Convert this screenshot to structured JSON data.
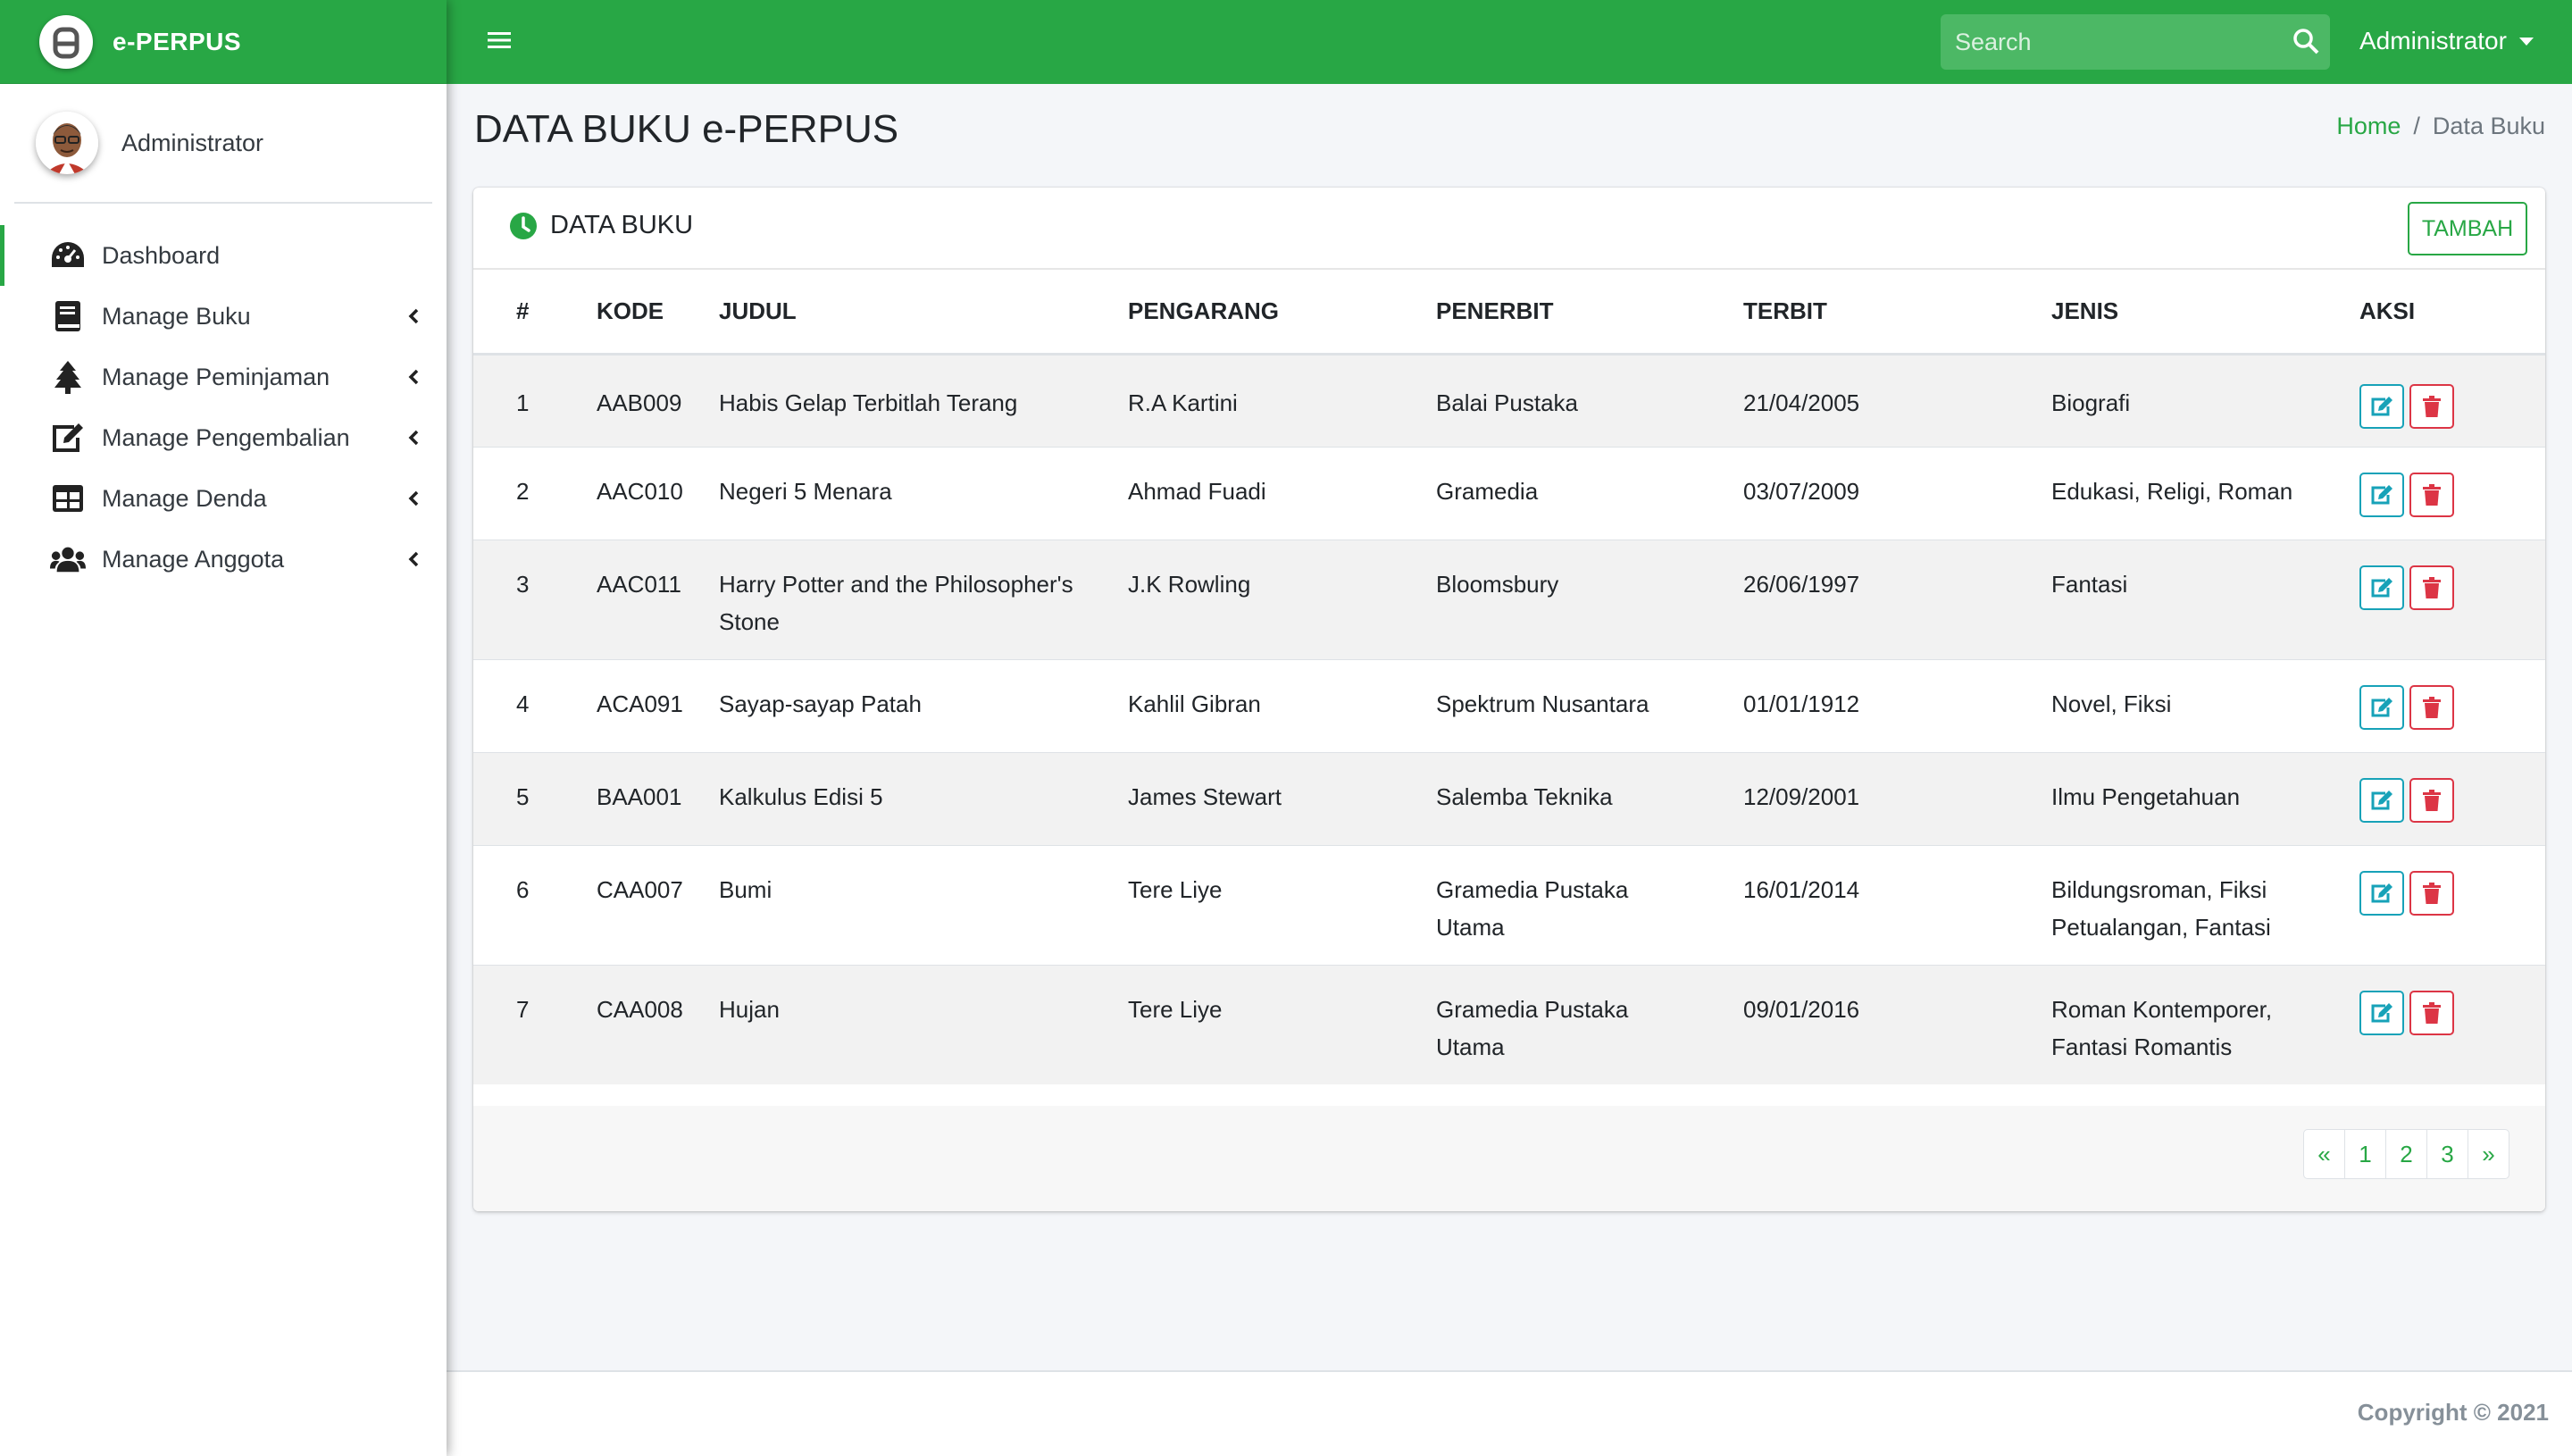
{
  "app": {
    "brand": "e-PERPUS",
    "user": "Administrator"
  },
  "topbar": {
    "search_placeholder": "Search",
    "user_menu": "Administrator"
  },
  "sidebar": {
    "items": [
      {
        "label": "Dashboard",
        "icon": "tachometer-icon"
      },
      {
        "label": "Manage Buku",
        "icon": "book-icon"
      },
      {
        "label": "Manage Peminjaman",
        "icon": "tree-icon"
      },
      {
        "label": "Manage Pengembalian",
        "icon": "edit-icon"
      },
      {
        "label": "Manage Denda",
        "icon": "table-icon"
      },
      {
        "label": "Manage Anggota",
        "icon": "users-icon"
      }
    ]
  },
  "page": {
    "title": "DATA BUKU e-PERPUS",
    "breadcrumb": {
      "home": "Home",
      "sep": "/",
      "current": "Data Buku"
    }
  },
  "card": {
    "title": "DATA BUKU",
    "add_button": "TAMBAH",
    "columns": [
      "#",
      "KODE",
      "JUDUL",
      "PENGARANG",
      "PENERBIT",
      "TERBIT",
      "JENIS",
      "AKSI"
    ],
    "rows": [
      {
        "no": "1",
        "kode": "AAB009",
        "judul": "Habis Gelap Terbitlah Terang",
        "pengarang": "R.A Kartini",
        "penerbit": "Balai Pustaka",
        "terbit": "21/04/2005",
        "jenis": "Biografi"
      },
      {
        "no": "2",
        "kode": "AAC010",
        "judul": "Negeri 5 Menara",
        "pengarang": "Ahmad Fuadi",
        "penerbit": "Gramedia",
        "terbit": "03/07/2009",
        "jenis": "Edukasi, Religi, Roman"
      },
      {
        "no": "3",
        "kode": "AAC011",
        "judul": "Harry Potter and the Philosopher's Stone",
        "pengarang": "J.K Rowling",
        "penerbit": "Bloomsbury",
        "terbit": "26/06/1997",
        "jenis": "Fantasi"
      },
      {
        "no": "4",
        "kode": "ACA091",
        "judul": "Sayap-sayap Patah",
        "pengarang": "Kahlil Gibran",
        "penerbit": "Spektrum Nusantara",
        "terbit": "01/01/1912",
        "jenis": "Novel, Fiksi"
      },
      {
        "no": "5",
        "kode": "BAA001",
        "judul": "Kalkulus Edisi 5",
        "pengarang": "James Stewart",
        "penerbit": "Salemba Teknika",
        "terbit": "12/09/2001",
        "jenis": "Ilmu Pengetahuan"
      },
      {
        "no": "6",
        "kode": "CAA007",
        "judul": "Bumi",
        "pengarang": "Tere Liye",
        "penerbit": "Gramedia Pustaka Utama",
        "terbit": "16/01/2014",
        "jenis": "Bildungsroman, Fiksi Petualangan, Fantasi"
      },
      {
        "no": "7",
        "kode": "CAA008",
        "judul": "Hujan",
        "pengarang": "Tere Liye",
        "penerbit": "Gramedia Pustaka Utama",
        "terbit": "09/01/2016",
        "jenis": "Roman Kontemporer, Fantasi Romantis"
      }
    ]
  },
  "pagination": [
    "«",
    "1",
    "2",
    "3",
    "»"
  ],
  "footer": {
    "copyright": "Copyright © 2021"
  },
  "colors": {
    "primary": "#28a745",
    "info": "#17a2b8",
    "danger": "#dc3545"
  }
}
